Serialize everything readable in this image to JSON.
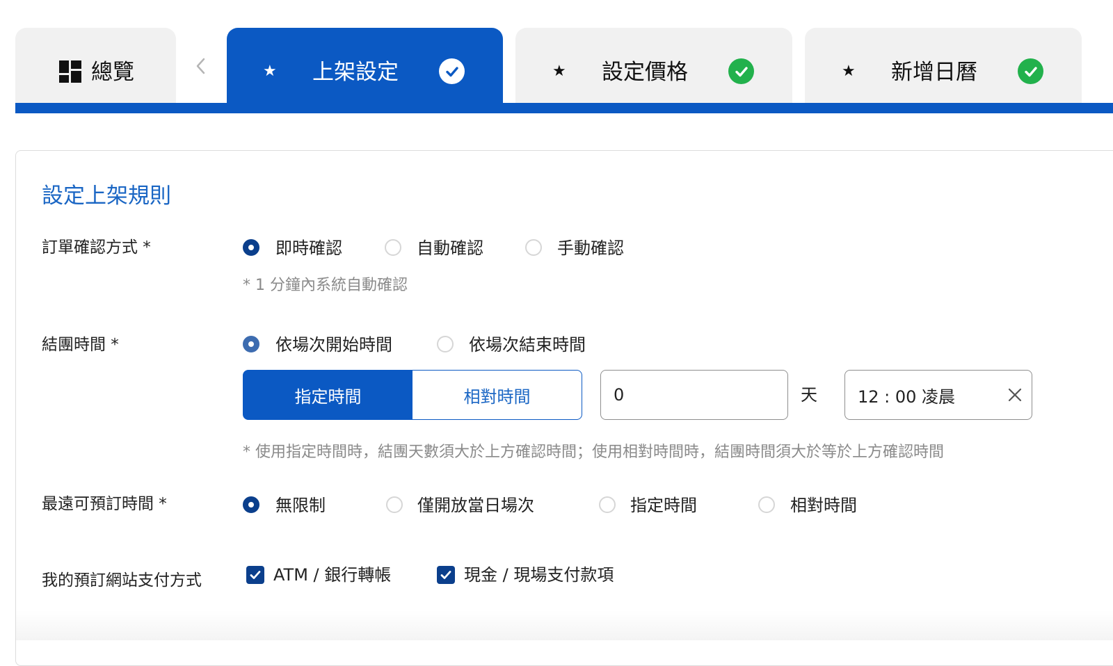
{
  "tabs": {
    "overview": {
      "label": "總覽",
      "icon": "grid-icon"
    },
    "back_icon": "chevron-left-icon",
    "items": [
      {
        "label": "上架設定",
        "marker": "★",
        "status": "completed",
        "active": true
      },
      {
        "label": "設定價格",
        "marker": "★",
        "status": "completed",
        "active": false
      },
      {
        "label": "新增日曆",
        "marker": "★",
        "status": "completed",
        "active": false
      }
    ]
  },
  "colors": {
    "primary": "#0b59c3",
    "title": "#1a66c4",
    "radio_selected": "#0b3f8c",
    "success": "#22b14c",
    "hint": "#8a8a8a"
  },
  "form": {
    "section_title": "設定上架規則",
    "confirmation": {
      "label": "訂單確認方式 *",
      "options": [
        "即時確認",
        "自動確認",
        "手動確認"
      ],
      "selected": "即時確認",
      "hint": "* 1 分鐘內系統自動確認"
    },
    "closing": {
      "label": "結團時間 *",
      "options": [
        "依場次開始時間",
        "依場次結束時間"
      ],
      "selected": "依場次開始時間",
      "modes": [
        "指定時間",
        "相對時間"
      ],
      "selected_mode": "指定時間",
      "days_value": "0",
      "days_unit": "天",
      "time_value": "12 : 00 凌晨",
      "hint": "* 使用指定時間時，結團天數須大於上方確認時間；使用相對時間時，結團時間須大於等於上方確認時間"
    },
    "booking_window": {
      "label": "最遠可預訂時間 *",
      "options": [
        "無限制",
        "僅開放當日場次",
        "指定時間",
        "相對時間"
      ],
      "selected": "無限制"
    },
    "payment": {
      "label": "我的預訂網站支付方式",
      "options": [
        {
          "label": "ATM / 銀行轉帳",
          "checked": true
        },
        {
          "label": "現金 / 現場支付款項",
          "checked": true
        }
      ]
    }
  }
}
